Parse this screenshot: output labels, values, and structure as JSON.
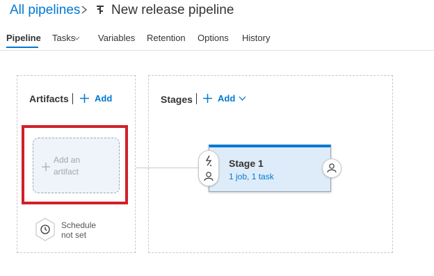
{
  "breadcrumb": {
    "parent_label": "All pipelines",
    "separator_icon": "chevron-right-icon",
    "pipeline_icon": "release-pipeline-icon",
    "title": "New release pipeline"
  },
  "tabs": [
    {
      "label": "Pipeline",
      "active": true
    },
    {
      "label": "Tasks",
      "active": false,
      "has_dropdown": true
    },
    {
      "label": "Variables",
      "active": false
    },
    {
      "label": "Retention",
      "active": false
    },
    {
      "label": "Options",
      "active": false
    },
    {
      "label": "History",
      "active": false
    }
  ],
  "artifacts": {
    "title": "Artifacts",
    "add_label": "Add",
    "placeholder_line1": "Add an",
    "placeholder_line2": "artifact",
    "schedule_line1": "Schedule",
    "schedule_line2": "not set"
  },
  "stages": {
    "title": "Stages",
    "add_label": "Add",
    "items": [
      {
        "name": "Stage 1",
        "summary": "1 job, 1 task"
      }
    ]
  },
  "colors": {
    "accent": "#0078d4",
    "highlight": "#d0202a",
    "stage_bg": "#deecf9"
  }
}
